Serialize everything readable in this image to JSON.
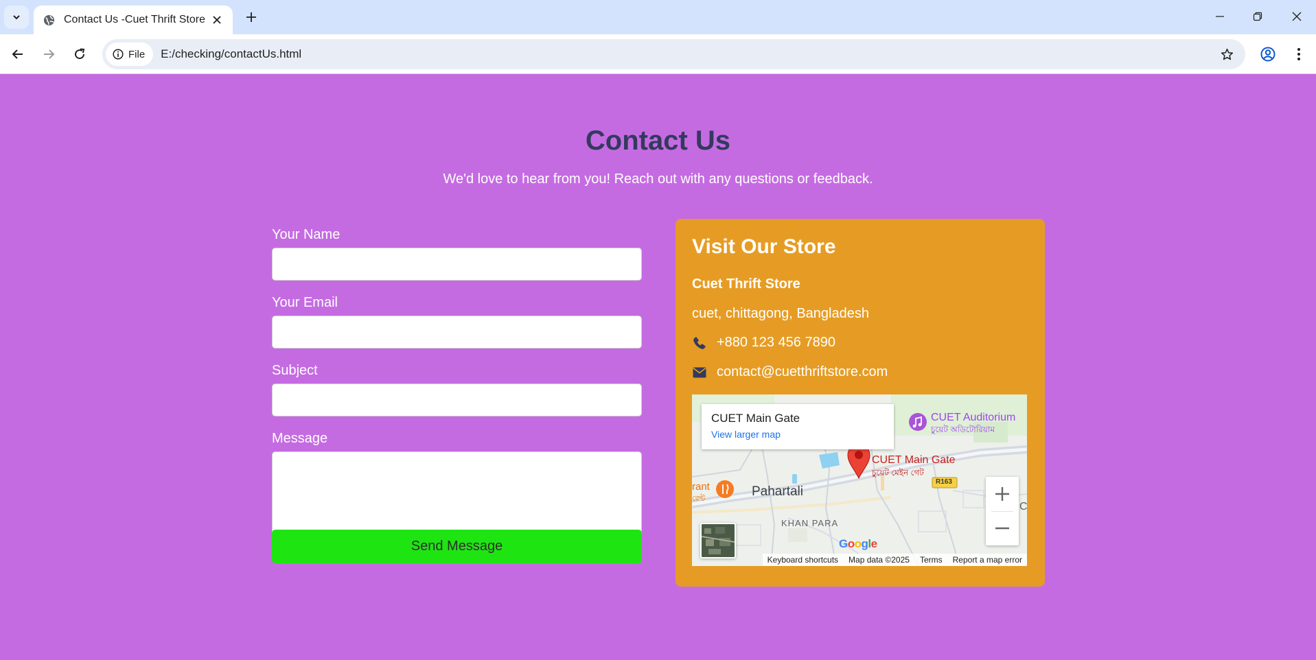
{
  "browser": {
    "tab_title": "Contact Us -Cuet Thrift Store",
    "site_chip_label": "File",
    "url": "E:/checking/contactUs.html"
  },
  "header": {
    "title": "Contact Us",
    "subtitle": "We'd love to hear from you! Reach out with any questions or feedback."
  },
  "form": {
    "name_label": "Your Name",
    "name_value": "",
    "email_label": "Your Email",
    "email_value": "",
    "subject_label": "Subject",
    "subject_value": "",
    "message_label": "Message",
    "message_value": "",
    "submit_label": "Send Message"
  },
  "store": {
    "heading": "Visit Our Store",
    "name": "Cuet Thrift Store",
    "address": "cuet, chittagong, Bangladesh",
    "phone": "+880 123 456 7890",
    "email": "contact@cuetthriftstore.com"
  },
  "map": {
    "place_title": "CUET Main Gate",
    "view_larger": "View larger map",
    "marker_label": "CUET Main Gate",
    "marker_label_bn": "চুয়েট মেইন গেট",
    "auditorium_label": "CUET Auditorium",
    "auditorium_label_bn": "চুয়েট অডিটোরিয়াম",
    "area_label": "Pahartali",
    "khan_para_label": "KHAN PARA",
    "restaurant_label": "rant",
    "restaurant_label_bn": "রেন্ট",
    "road_label": "R163",
    "edge_letter": "C",
    "google_logo": "Google",
    "footer": {
      "shortcuts": "Keyboard shortcuts",
      "map_data": "Map data ©2025",
      "terms": "Terms",
      "report": "Report a map error"
    }
  },
  "colors": {
    "page_background": "#c56be2",
    "title_color": "#333a5e",
    "store_card": "#e69c24",
    "submit_button": "#1ee512",
    "marker_red": "#ea4335"
  }
}
